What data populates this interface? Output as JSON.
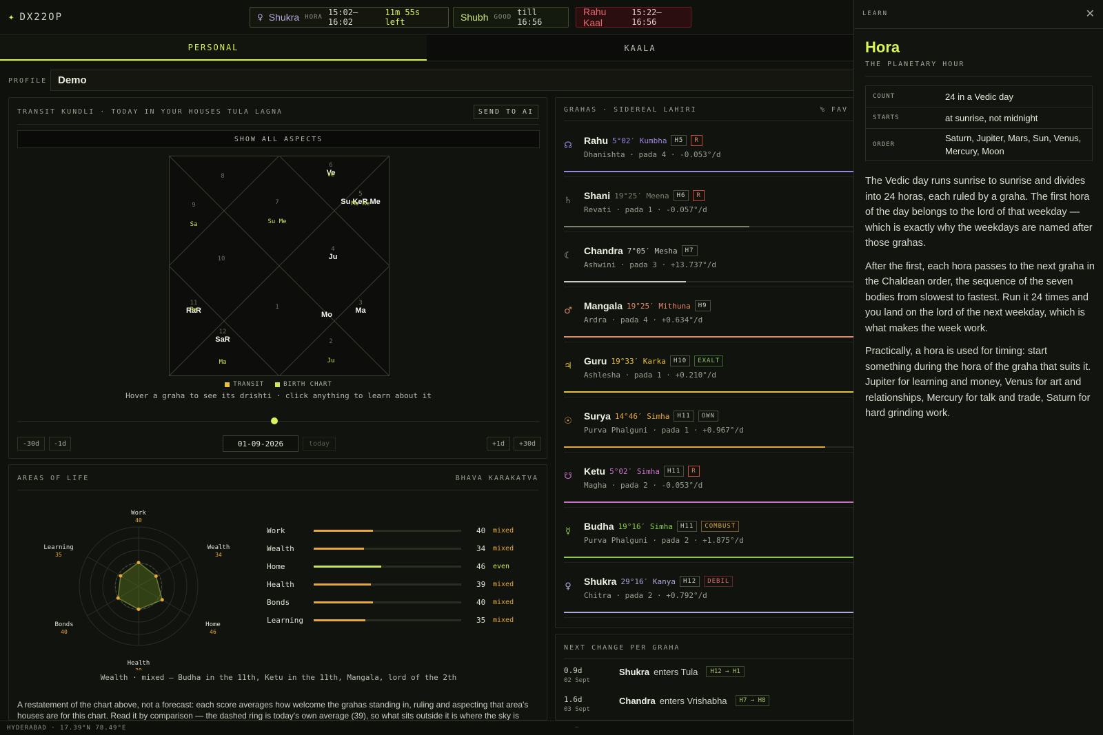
{
  "app": {
    "logo": "DX22OP",
    "logo_star": "✦"
  },
  "status": {
    "hora": {
      "icon": "venus-icon",
      "glyph": "♀",
      "name": "Shukra",
      "tag": "HORA",
      "range": "15:02–16:02",
      "left": "11m 55s left"
    },
    "shubh": {
      "name": "Shubh",
      "tag": "GOOD",
      "till": "till 16:56"
    },
    "rahu": {
      "name": "Rahu Kaal",
      "range": "15:22–16:56"
    }
  },
  "tabs": [
    {
      "label": "PERSONAL"
    },
    {
      "label": "KAALA"
    }
  ],
  "profile": {
    "label": "PROFILE",
    "value": "Demo"
  },
  "kundli": {
    "heading": "TRANSIT KUNDLI · TODAY IN YOUR HOUSES TULA LAGNA",
    "send_label": "SEND TO AI",
    "aspects_label": "SHOW ALL ASPECTS",
    "legend": [
      {
        "label": "TRANSIT",
        "color": "#e8c13a"
      },
      {
        "label": "BIRTH CHART",
        "color": "#c8e85a"
      }
    ],
    "hint": "Hover a graha to see its drishti · click anything to learn about it",
    "houses": [
      {
        "num": "1",
        "transit": "Mo",
        "birth": ""
      },
      {
        "num": "2",
        "transit": "",
        "birth": "Ju"
      },
      {
        "num": "3",
        "transit": "Ma",
        "birth": ""
      },
      {
        "num": "4",
        "transit": "Ju",
        "birth": ""
      },
      {
        "num": "5",
        "transit": "Su  KeR Me",
        "birth": "Mo Ke"
      },
      {
        "num": "6",
        "transit": "Ve",
        "birth": "Ve"
      },
      {
        "num": "7",
        "transit": "",
        "birth": "Su Me"
      },
      {
        "num": "8",
        "transit": "",
        "birth": ""
      },
      {
        "num": "9",
        "transit": "",
        "birth": "Sa"
      },
      {
        "num": "10",
        "transit": "",
        "birth": ""
      },
      {
        "num": "11",
        "transit": "RaR",
        "birth": "Ra"
      },
      {
        "num": "12",
        "transit": "SaR",
        "birth": "Ma"
      }
    ],
    "nav": {
      "minus30": "-30d",
      "minus1": "-1d",
      "date": "01-09-2026",
      "today": "today",
      "plus1": "+1d",
      "plus30": "+30d"
    }
  },
  "areas": {
    "heading": "AREAS OF LIFE",
    "heading_right": "BHAVA KARAKATVA",
    "items": [
      {
        "label": "Work",
        "value": 40,
        "verdict": "mixed"
      },
      {
        "label": "Wealth",
        "value": 34,
        "verdict": "mixed"
      },
      {
        "label": "Home",
        "value": 46,
        "verdict": "even"
      },
      {
        "label": "Health",
        "value": 39,
        "verdict": "mixed"
      },
      {
        "label": "Bonds",
        "value": 40,
        "verdict": "mixed"
      },
      {
        "label": "Learning",
        "value": 35,
        "verdict": "mixed"
      }
    ],
    "colors": {
      "mixed": "#e8a93a",
      "even": "#c8e85a"
    },
    "caption": "Wealth · mixed — Budha in the 11th, Ketu in the 11th, Mangala, lord of the 2th",
    "note": "A restatement of the chart above, not a forecast: each score averages how welcome the grahas standing in, ruling and aspecting that area's houses are for this chart. Read it by comparison — the dashed ring is today's own average (39), so what sits outside it is where the sky is"
  },
  "grahas": {
    "heading": "GRAHAS · SIDEREAL LAHIRI",
    "heading_right": "% FAV",
    "items": [
      {
        "icon": "rahu-icon",
        "glyph": "☊",
        "name": "Rahu",
        "pos": "5°02′ Kumbha",
        "house": "H5",
        "flag": "R",
        "flag_kind": "retro",
        "sub": "Dhanishta · pada 4 · -0.053°/d",
        "color": "#9b86e0",
        "fav": 1.0
      },
      {
        "icon": "saturn-icon",
        "glyph": "♄",
        "name": "Shani",
        "pos": "19°25′ Meena",
        "house": "H6",
        "flag": "R",
        "flag_kind": "retro",
        "sub": "Revati · pada 1 · -0.057°/d",
        "color": "#7d8070",
        "fav": 0.64
      },
      {
        "icon": "moon-icon",
        "glyph": "☾",
        "name": "Chandra",
        "pos": "7°05′ Mesha",
        "house": "H7",
        "flag": "",
        "flag_kind": "",
        "sub": "Ashwini · pada 3 · +13.737°/d",
        "color": "#c9ccc2",
        "fav": 0.42
      },
      {
        "icon": "mars-icon",
        "glyph": "♂",
        "name": "Mangala",
        "pos": "19°25′ Mithuna",
        "house": "H9",
        "flag": "",
        "flag_kind": "",
        "sub": "Ardra · pada 4 · +0.634°/d",
        "color": "#e08a6a",
        "fav": 1.0
      },
      {
        "icon": "jupiter-icon",
        "glyph": "♃",
        "name": "Guru",
        "pos": "19°33′ Karka",
        "house": "H10",
        "flag": "EXALT",
        "flag_kind": "exalt",
        "sub": "Ashlesha · pada 1 · +0.210°/d",
        "color": "#e8c13a",
        "fav": 1.0
      },
      {
        "icon": "sun-icon",
        "glyph": "☉",
        "name": "Surya",
        "pos": "14°46′ Simha",
        "house": "H11",
        "flag": "OWN",
        "flag_kind": "own",
        "sub": "Purva Phalguni · pada 1 · +0.967°/d",
        "color": "#e8a93a",
        "fav": 0.9
      },
      {
        "icon": "ketu-icon",
        "glyph": "☋",
        "name": "Ketu",
        "pos": "5°02′ Simha",
        "house": "H11",
        "flag": "R",
        "flag_kind": "retro",
        "sub": "Magha · pada 2 · -0.053°/d",
        "color": "#c873c8",
        "fav": 1.0
      },
      {
        "icon": "mercury-icon",
        "glyph": "☿",
        "name": "Budha",
        "pos": "19°16′ Simha",
        "house": "H11",
        "flag": "COMBUST",
        "flag_kind": "combust",
        "sub": "Purva Phalguni · pada 2 · +1.875°/d",
        "color": "#8cc84a",
        "fav": 1.0
      },
      {
        "icon": "venus-icon",
        "glyph": "♀",
        "name": "Shukra",
        "pos": "29°16′ Kanya",
        "house": "H12",
        "flag": "DEBIL",
        "flag_kind": "debil",
        "sub": "Chitra · pada 2 · +0.792°/d",
        "color": "#b3a6d9",
        "fav": 1.0
      }
    ]
  },
  "next_change": {
    "heading": "NEXT CHANGE PER GRAHA",
    "items": [
      {
        "delta": "0.9d",
        "date": "02 Sept",
        "graha": "Shukra",
        "verb": "enters Tula",
        "houses": "H12 → H1"
      },
      {
        "delta": "1.6d",
        "date": "03 Sept",
        "graha": "Chandra",
        "verb": "enters Vrishabha",
        "houses": "H7 → H8"
      }
    ]
  },
  "footer": {
    "location": "HYDERABAD · 17.39°N 78.49°E",
    "dash": "–"
  },
  "learn": {
    "heading": "LEARN",
    "close": "✕",
    "title": "Hora",
    "subtitle": "THE PLANETARY HOUR",
    "facts": [
      {
        "k": "COUNT",
        "v": "24 in a Vedic day"
      },
      {
        "k": "STARTS",
        "v": "at sunrise, not midnight"
      },
      {
        "k": "ORDER",
        "v": "Saturn, Jupiter, Mars, Sun, Venus, Mercury, Moon"
      }
    ],
    "paras": [
      "The Vedic day runs sunrise to sunrise and divides into 24 horas, each ruled by a graha. The first hora of the day belongs to the lord of that weekday — which is exactly why the weekdays are named after those grahas.",
      "After the first, each hora passes to the next graha in the Chaldean order, the sequence of the seven bodies from slowest to fastest. Run it 24 times and you land on the lord of the next weekday, which is what makes the week work.",
      "Practically, a hora is used for timing: start something during the hora of the graha that suits it. Jupiter for learning and money, Venus for art and relationships, Mercury for talk and trade, Saturn for hard grinding work."
    ]
  }
}
